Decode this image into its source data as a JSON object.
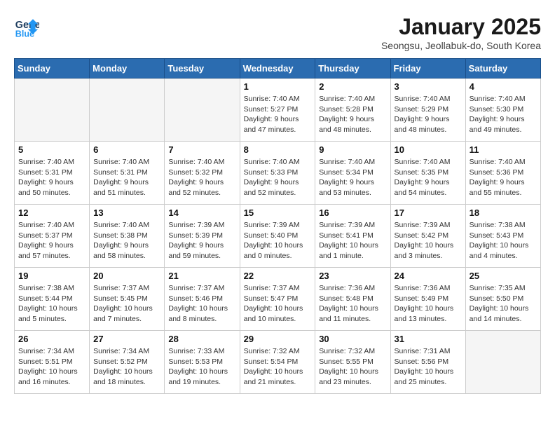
{
  "header": {
    "logo_line1": "General",
    "logo_line2": "Blue",
    "title": "January 2025",
    "subtitle": "Seongsu, Jeollabuk-do, South Korea"
  },
  "weekdays": [
    "Sunday",
    "Monday",
    "Tuesday",
    "Wednesday",
    "Thursday",
    "Friday",
    "Saturday"
  ],
  "weeks": [
    [
      {
        "day": "",
        "info": ""
      },
      {
        "day": "",
        "info": ""
      },
      {
        "day": "",
        "info": ""
      },
      {
        "day": "1",
        "info": "Sunrise: 7:40 AM\nSunset: 5:27 PM\nDaylight: 9 hours\nand 47 minutes."
      },
      {
        "day": "2",
        "info": "Sunrise: 7:40 AM\nSunset: 5:28 PM\nDaylight: 9 hours\nand 48 minutes."
      },
      {
        "day": "3",
        "info": "Sunrise: 7:40 AM\nSunset: 5:29 PM\nDaylight: 9 hours\nand 48 minutes."
      },
      {
        "day": "4",
        "info": "Sunrise: 7:40 AM\nSunset: 5:30 PM\nDaylight: 9 hours\nand 49 minutes."
      }
    ],
    [
      {
        "day": "5",
        "info": "Sunrise: 7:40 AM\nSunset: 5:31 PM\nDaylight: 9 hours\nand 50 minutes."
      },
      {
        "day": "6",
        "info": "Sunrise: 7:40 AM\nSunset: 5:31 PM\nDaylight: 9 hours\nand 51 minutes."
      },
      {
        "day": "7",
        "info": "Sunrise: 7:40 AM\nSunset: 5:32 PM\nDaylight: 9 hours\nand 52 minutes."
      },
      {
        "day": "8",
        "info": "Sunrise: 7:40 AM\nSunset: 5:33 PM\nDaylight: 9 hours\nand 52 minutes."
      },
      {
        "day": "9",
        "info": "Sunrise: 7:40 AM\nSunset: 5:34 PM\nDaylight: 9 hours\nand 53 minutes."
      },
      {
        "day": "10",
        "info": "Sunrise: 7:40 AM\nSunset: 5:35 PM\nDaylight: 9 hours\nand 54 minutes."
      },
      {
        "day": "11",
        "info": "Sunrise: 7:40 AM\nSunset: 5:36 PM\nDaylight: 9 hours\nand 55 minutes."
      }
    ],
    [
      {
        "day": "12",
        "info": "Sunrise: 7:40 AM\nSunset: 5:37 PM\nDaylight: 9 hours\nand 57 minutes."
      },
      {
        "day": "13",
        "info": "Sunrise: 7:40 AM\nSunset: 5:38 PM\nDaylight: 9 hours\nand 58 minutes."
      },
      {
        "day": "14",
        "info": "Sunrise: 7:39 AM\nSunset: 5:39 PM\nDaylight: 9 hours\nand 59 minutes."
      },
      {
        "day": "15",
        "info": "Sunrise: 7:39 AM\nSunset: 5:40 PM\nDaylight: 10 hours\nand 0 minutes."
      },
      {
        "day": "16",
        "info": "Sunrise: 7:39 AM\nSunset: 5:41 PM\nDaylight: 10 hours\nand 1 minute."
      },
      {
        "day": "17",
        "info": "Sunrise: 7:39 AM\nSunset: 5:42 PM\nDaylight: 10 hours\nand 3 minutes."
      },
      {
        "day": "18",
        "info": "Sunrise: 7:38 AM\nSunset: 5:43 PM\nDaylight: 10 hours\nand 4 minutes."
      }
    ],
    [
      {
        "day": "19",
        "info": "Sunrise: 7:38 AM\nSunset: 5:44 PM\nDaylight: 10 hours\nand 5 minutes."
      },
      {
        "day": "20",
        "info": "Sunrise: 7:37 AM\nSunset: 5:45 PM\nDaylight: 10 hours\nand 7 minutes."
      },
      {
        "day": "21",
        "info": "Sunrise: 7:37 AM\nSunset: 5:46 PM\nDaylight: 10 hours\nand 8 minutes."
      },
      {
        "day": "22",
        "info": "Sunrise: 7:37 AM\nSunset: 5:47 PM\nDaylight: 10 hours\nand 10 minutes."
      },
      {
        "day": "23",
        "info": "Sunrise: 7:36 AM\nSunset: 5:48 PM\nDaylight: 10 hours\nand 11 minutes."
      },
      {
        "day": "24",
        "info": "Sunrise: 7:36 AM\nSunset: 5:49 PM\nDaylight: 10 hours\nand 13 minutes."
      },
      {
        "day": "25",
        "info": "Sunrise: 7:35 AM\nSunset: 5:50 PM\nDaylight: 10 hours\nand 14 minutes."
      }
    ],
    [
      {
        "day": "26",
        "info": "Sunrise: 7:34 AM\nSunset: 5:51 PM\nDaylight: 10 hours\nand 16 minutes."
      },
      {
        "day": "27",
        "info": "Sunrise: 7:34 AM\nSunset: 5:52 PM\nDaylight: 10 hours\nand 18 minutes."
      },
      {
        "day": "28",
        "info": "Sunrise: 7:33 AM\nSunset: 5:53 PM\nDaylight: 10 hours\nand 19 minutes."
      },
      {
        "day": "29",
        "info": "Sunrise: 7:32 AM\nSunset: 5:54 PM\nDaylight: 10 hours\nand 21 minutes."
      },
      {
        "day": "30",
        "info": "Sunrise: 7:32 AM\nSunset: 5:55 PM\nDaylight: 10 hours\nand 23 minutes."
      },
      {
        "day": "31",
        "info": "Sunrise: 7:31 AM\nSunset: 5:56 PM\nDaylight: 10 hours\nand 25 minutes."
      },
      {
        "day": "",
        "info": ""
      }
    ]
  ]
}
